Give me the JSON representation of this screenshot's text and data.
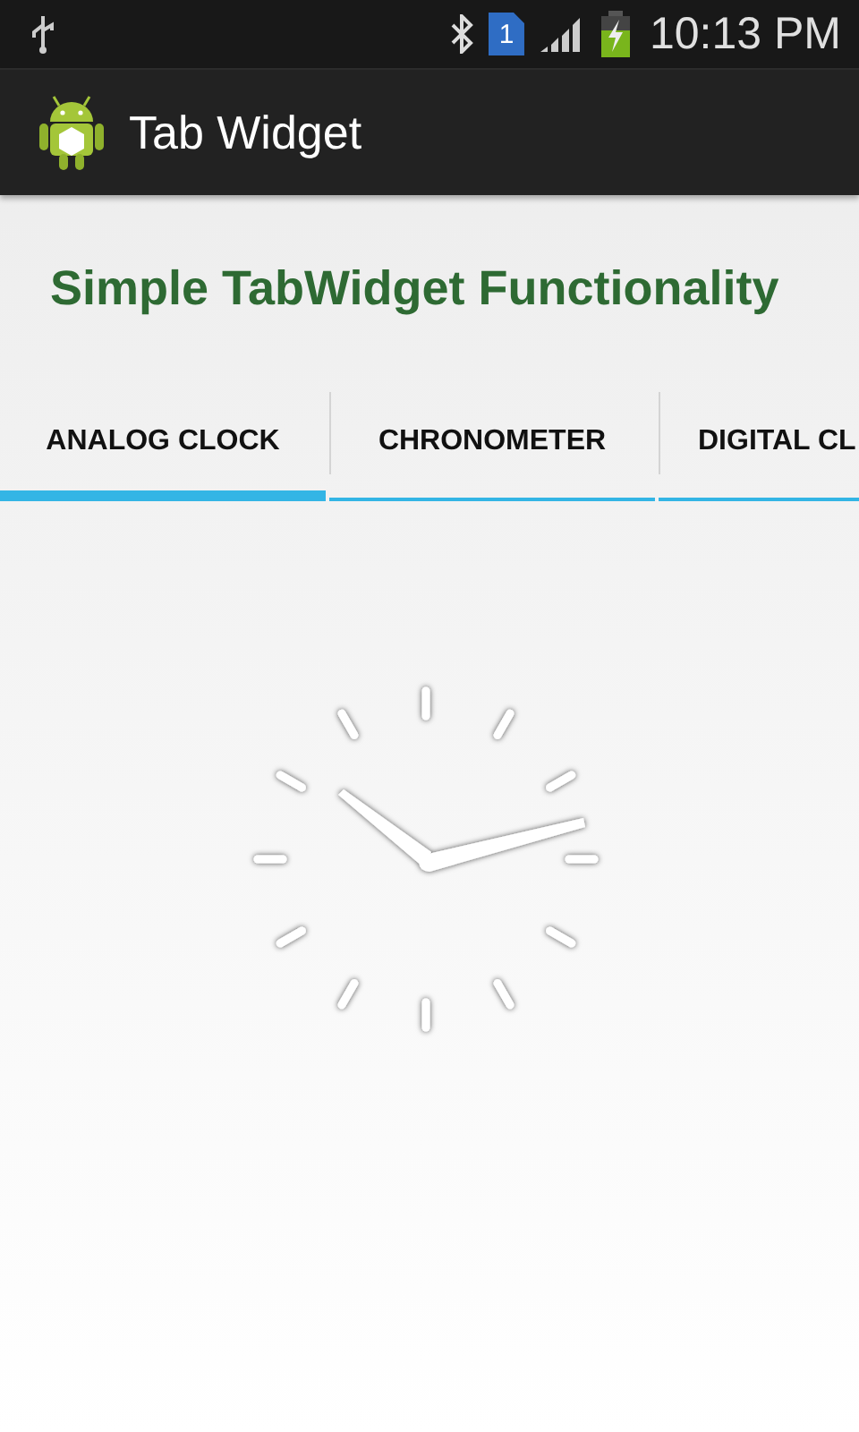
{
  "status_bar": {
    "time": "10:13 PM",
    "sim_badge": "1"
  },
  "action_bar": {
    "title": "Tab Widget"
  },
  "heading": "Simple TabWidget Functionality",
  "tabs": [
    {
      "label": "ANALOG CLOCK",
      "selected": true
    },
    {
      "label": "CHRONOMETER",
      "selected": false
    },
    {
      "label": "DIGITAL CL",
      "selected": false
    }
  ]
}
